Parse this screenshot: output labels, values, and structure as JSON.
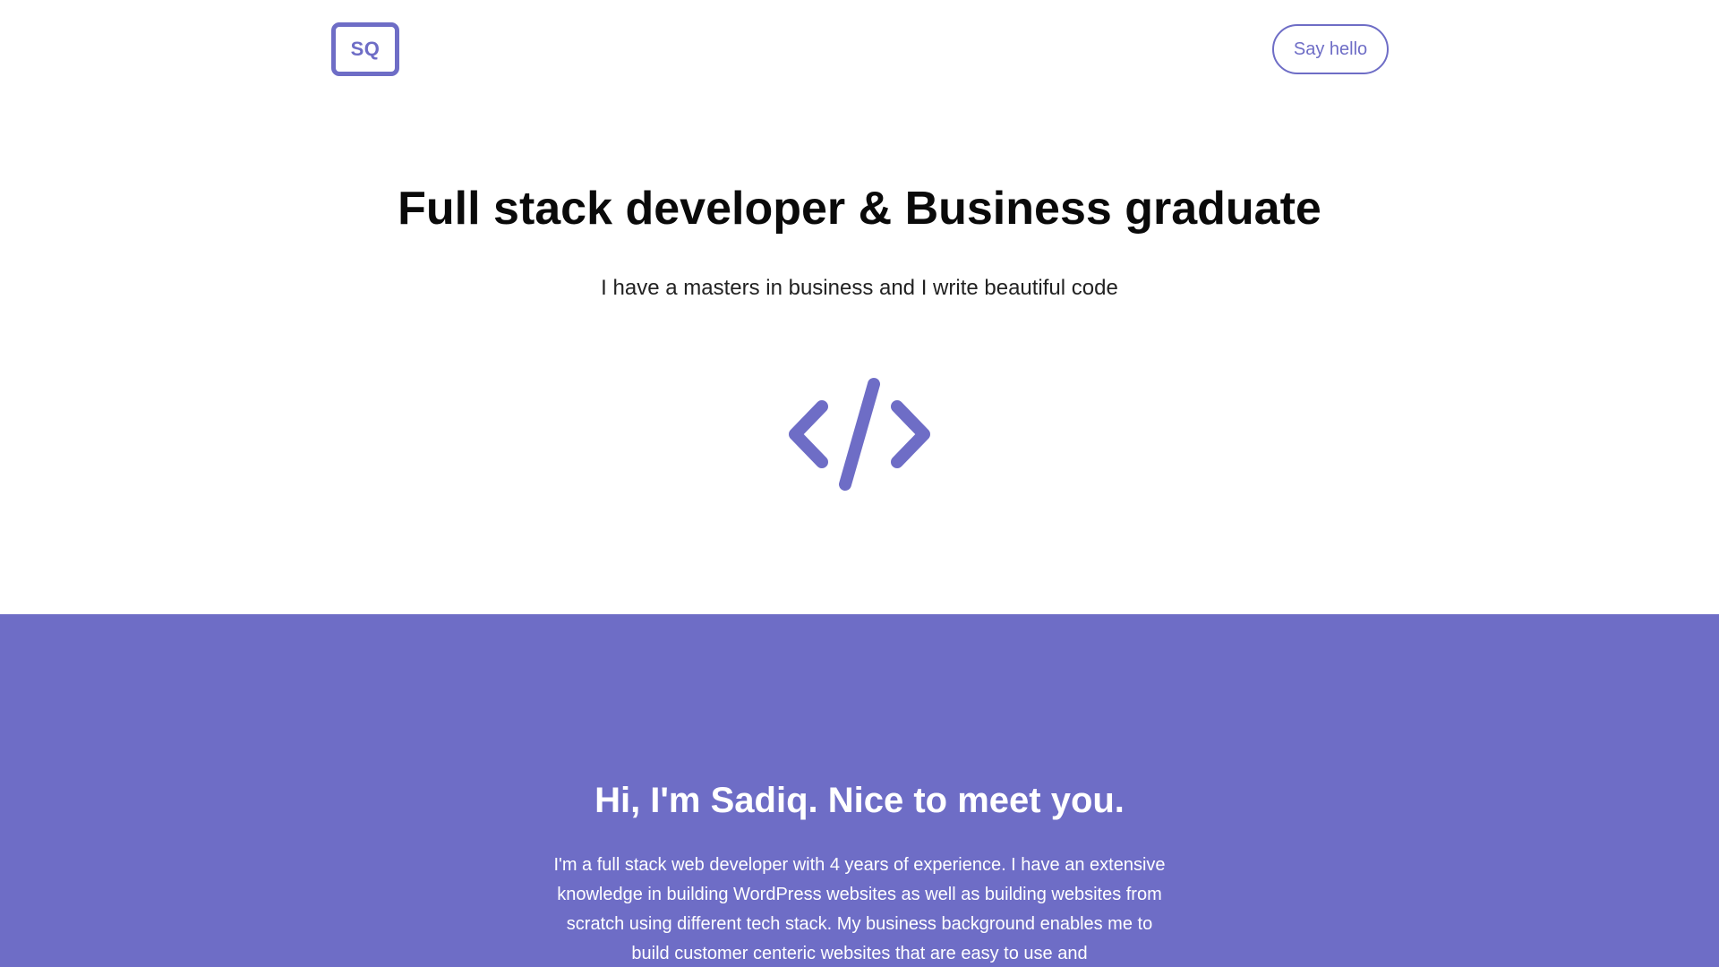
{
  "header": {
    "logo_text": "SQ",
    "say_hello_label": "Say hello"
  },
  "hero": {
    "title": "Full stack developer & Business graduate",
    "subtitle": "I have a masters in business and I write beautiful code",
    "icon": "code-icon"
  },
  "about": {
    "title": "Hi, I'm Sadiq. Nice to meet you.",
    "text": "I'm a full stack web developer with 4 years of experience. I have an extensive knowledge in building WordPress websites as well as building websites from scratch using different tech stack. My business background enables me to build customer centeric websites that are easy to use and"
  },
  "colors": {
    "accent": "#6e6dc6",
    "background": "#ffffff",
    "heading": "#0a0a0a",
    "about_text": "#ffffff"
  }
}
